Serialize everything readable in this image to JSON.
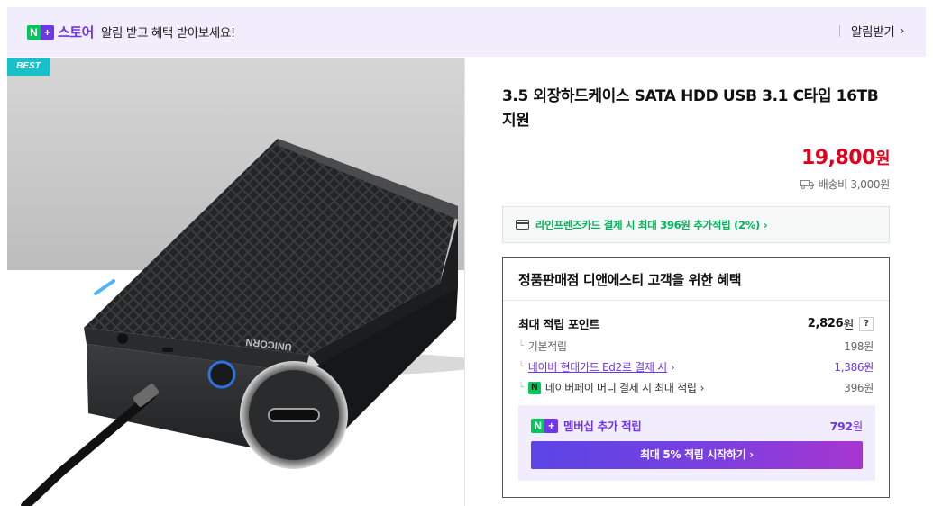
{
  "header": {
    "nplus_n": "N",
    "nplus_plus": "+",
    "brand": "스토어",
    "promo": "알림 받고 혜택 받아보세요!",
    "notify_label": "알림받기",
    "notify_chevron": "›"
  },
  "gallery": {
    "badge": "BEST",
    "device_brand": "UNICORN"
  },
  "product": {
    "title": "3.5 외장하드케이스 SATA HDD USB 3.1 C타입 16TB 지원",
    "price": "19,800",
    "price_unit": "원",
    "shipping": "배송비 3,000원"
  },
  "card_promo": {
    "text": "라인프렌즈카드 결제 시 최대 396원 추가적립 (2%)",
    "chevron": "›"
  },
  "benefit": {
    "heading": "정품판매점 디앤에스티 고객을 위한 혜택",
    "max_points_label": "최대 적립 포인트",
    "max_points_value": "2,826",
    "max_points_unit": "원",
    "help": "?",
    "tick": "└",
    "rows": [
      {
        "label": "기본적립",
        "value": "198원"
      },
      {
        "label": "네이버 현대카드 Ed2로 결제 시",
        "chevron": "›",
        "value": "1,386원"
      },
      {
        "badge": "N",
        "label": "네이버페이 머니 결제 시 최대 적립",
        "chevron": "›",
        "value": "396원"
      }
    ],
    "membership": {
      "label": "멤버십 추가 적립",
      "value": "792",
      "unit": "원",
      "cta": "최대 5% 적립 시작하기 ›"
    }
  },
  "colors": {
    "naver_green": "#03c75a",
    "naver_purple": "#6e36e8",
    "price_red": "#e0001e",
    "best_badge": "#19bfc9"
  }
}
